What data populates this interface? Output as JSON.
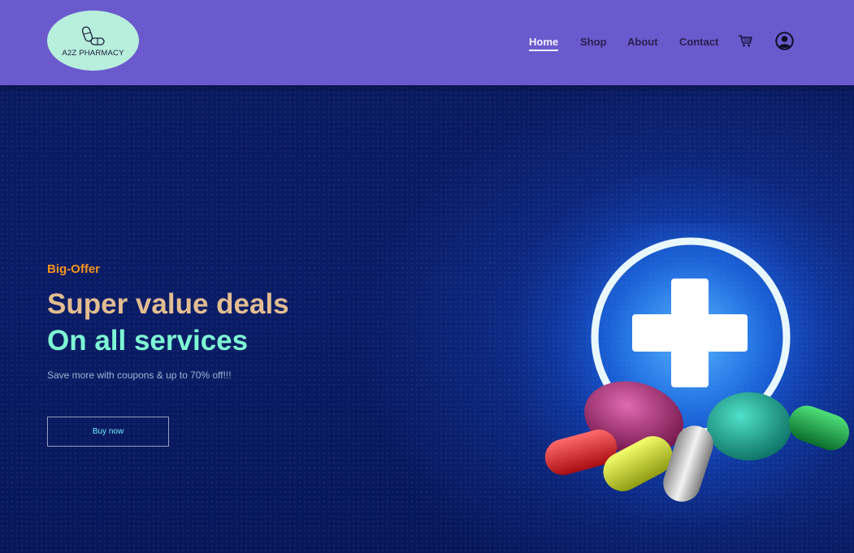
{
  "brand": {
    "name": "A2Z PHARMACY",
    "tagline": "",
    "logo_icon": "pills-icon",
    "logo_bg": "#b8eedc"
  },
  "nav": {
    "items": [
      {
        "label": "Home",
        "active": true
      },
      {
        "label": "Shop",
        "active": false
      },
      {
        "label": "About",
        "active": false
      },
      {
        "label": "Contact",
        "active": false
      }
    ],
    "cart_icon": "cart-icon",
    "user_icon": "user-circle-icon"
  },
  "hero": {
    "tag": "Big-Offer",
    "title_line1": "Super value deals",
    "title_line2": "On all services",
    "subtitle": "Save more with coupons & up to 70% off!!!",
    "button_label": "Buy now",
    "image_icon": "medical-cross-pills-illustration"
  },
  "colors": {
    "header_bg": "#6a5acd",
    "hero_bg": "#0a1c66",
    "tag": "#f7941d",
    "title1": "#e3bd91",
    "title2": "#7ef7d3",
    "button_text": "#6ff0ff"
  }
}
